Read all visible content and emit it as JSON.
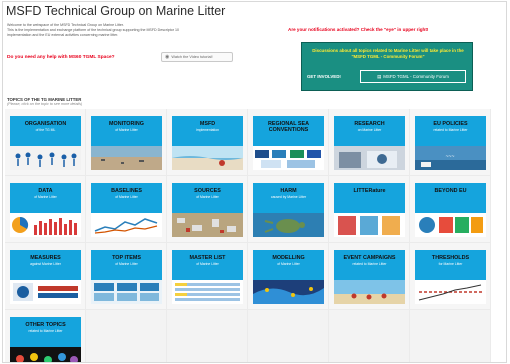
{
  "header": {
    "title": "MSFD Technical Group on Marine Litter",
    "intro_lines": [
      "Welcome to the webspace of the MSFD Technical Group on Marine Litter.",
      "This is the implementation and exchange platform of the technical group supporting the MSFD Descriptor 10",
      "implementation and the EU external activities concerning marine litter."
    ],
    "help_question": "Do you need any help with MS60 TGML Space?",
    "video_button": "Watch the Video tutorial!",
    "notifications": "Are your notifications activated? Check the \"eye\" in upper right!"
  },
  "forum": {
    "text": "Discussions about all topics related to Marine Litter will take place in the \"MSFD TGML - Community Forum\"",
    "get_involved": "GET INVOLVED!",
    "button": "MSFD TGML - Community Forum"
  },
  "topics": {
    "heading": "TOPICS OF THE TG MARINE LITTER",
    "subheading": "(Please, click on the topic to see more details)",
    "tiles": [
      {
        "title": "ORGANISATION",
        "sub": "of the TG ML",
        "img": "people"
      },
      {
        "title": "MONITORING",
        "sub": "of Marine Litter",
        "img": "beach"
      },
      {
        "title": "MSFD",
        "sub": "implementation",
        "img": "sea"
      },
      {
        "title": "REGIONAL SEA",
        "title2": "CONVENTIONS",
        "sub": "",
        "img": "logos"
      },
      {
        "title": "RESEARCH",
        "sub": "on Marine Litter",
        "img": "lab"
      },
      {
        "title": "EU POLICIES",
        "sub": "related to Marine Litter",
        "img": "plastic"
      },
      {
        "title": "DATA",
        "sub": "of Marine Litter",
        "img": "chart"
      },
      {
        "title": "BASELINES",
        "sub": "of Marine Litter",
        "img": "graph"
      },
      {
        "title": "SOURCES",
        "sub": "of Marine Litter",
        "img": "debris"
      },
      {
        "title": "HARM",
        "sub": "caused by Marine Litter",
        "img": "turtle"
      },
      {
        "title": "LITTERature",
        "sub": "",
        "img": "docs"
      },
      {
        "title": "BEYOND EU",
        "sub": "",
        "img": "global"
      },
      {
        "title": "MEASURES",
        "sub": "against Marine Litter",
        "img": "measures"
      },
      {
        "title": "TOP ITEMS",
        "sub": "of Marine Litter",
        "img": "items"
      },
      {
        "title": "MASTER LIST",
        "sub": "of Marine Litter",
        "img": "list"
      },
      {
        "title": "MODELLING",
        "sub": "of Marine Litter",
        "img": "model"
      },
      {
        "title": "EVENT CAMPAIGNS",
        "sub": "related to Marine Litter",
        "img": "event"
      },
      {
        "title": "THRESHOLDS",
        "sub": "for Marine Litter",
        "img": "threshold"
      },
      {
        "title": "OTHER TOPICS",
        "sub": "related to Marine Litter",
        "img": "other"
      }
    ]
  }
}
